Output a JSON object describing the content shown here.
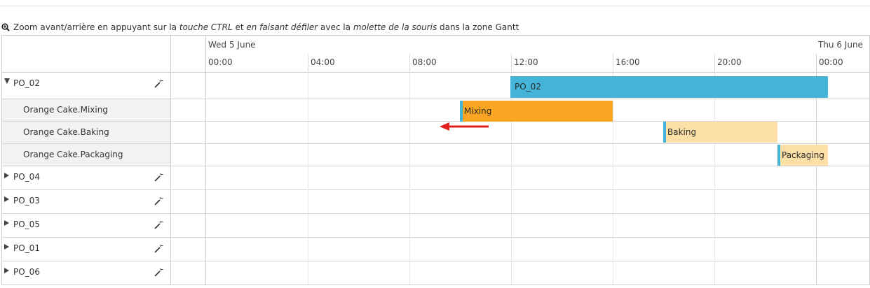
{
  "hint": {
    "part1": "Zoom avant/arrière en appuyant sur la ",
    "part2": "touche CTRL",
    "part3": " et ",
    "part4": "en faisant défiler",
    "part5": " avec la ",
    "part6": "molette de la souris",
    "part7": " dans la zone Gantt",
    "icon": "zoom-icon"
  },
  "timeline": {
    "days": [
      {
        "label": "Wed 5 June"
      },
      {
        "label": "Thu 6 June"
      }
    ],
    "ticks": [
      "00:00",
      "04:00",
      "08:00",
      "12:00",
      "16:00",
      "20:00",
      "00:00"
    ]
  },
  "rows": [
    {
      "label": "PO_02",
      "expanded": true,
      "type": "parent",
      "icon": "magic-wand-icon"
    },
    {
      "label": "Orange Cake.Mixing",
      "type": "child"
    },
    {
      "label": "Orange Cake.Baking",
      "type": "child"
    },
    {
      "label": "Orange Cake.Packaging",
      "type": "child"
    },
    {
      "label": "PO_04",
      "expanded": false,
      "type": "parent",
      "icon": "magic-wand-icon"
    },
    {
      "label": "PO_03",
      "expanded": false,
      "type": "parent",
      "icon": "magic-wand-icon"
    },
    {
      "label": "PO_05",
      "expanded": false,
      "type": "parent",
      "icon": "magic-wand-icon"
    },
    {
      "label": "PO_01",
      "expanded": false,
      "type": "parent",
      "icon": "magic-wand-icon"
    },
    {
      "label": "PO_06",
      "expanded": false,
      "type": "parent",
      "icon": "magic-wand-icon"
    }
  ],
  "bars": [
    {
      "label": "PO_02",
      "color": "#45b4d9",
      "textColor": "#2b2b2b",
      "start": "12:00",
      "end": "01:00"
    },
    {
      "label": "Mixing",
      "color": "#faa622",
      "textColor": "#2b2b2b",
      "start": "10:00",
      "end": "16:00"
    },
    {
      "label": "Baking",
      "color": "#fde0a8",
      "textColor": "#2b2b2b",
      "start": "18:00",
      "end": "22:30"
    },
    {
      "label": "Packaging",
      "color": "#fde0a8",
      "textColor": "#2b2b2b",
      "start": "22:30",
      "end": "00:30"
    }
  ],
  "colors": {
    "accent": "#45b4d9",
    "active_bar": "#faa622",
    "pending_bar": "#fde0a8",
    "arrow": "#e0201b"
  }
}
